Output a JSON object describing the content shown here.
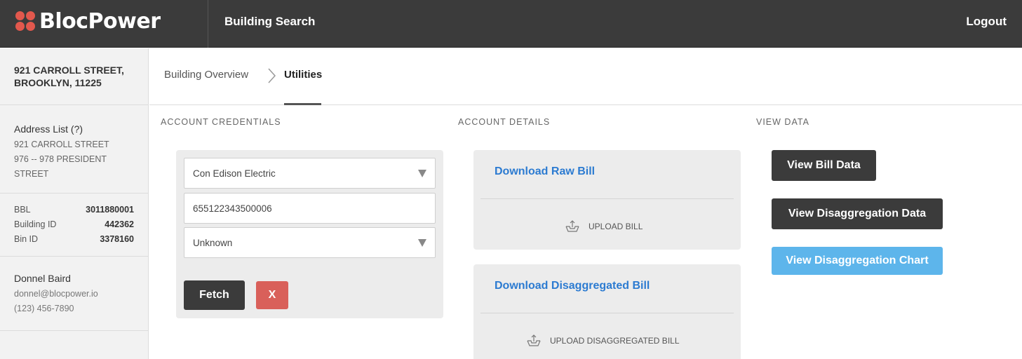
{
  "header": {
    "brand": "BlocPower",
    "nav_link": "Building Search",
    "logout": "Logout",
    "brand_color": "#e2584d"
  },
  "sidebar": {
    "address": "921 CARROLL STREET, BROOKLYN, 11225",
    "address_list": {
      "title": "Address List (?)",
      "items": [
        "921 CARROLL STREET",
        "976 -- 978 PRESIDENT STREET"
      ]
    },
    "ids": [
      {
        "label": "BBL",
        "value": "3011880001"
      },
      {
        "label": "Building ID",
        "value": "442362"
      },
      {
        "label": "Bin ID",
        "value": "3378160"
      }
    ],
    "contact": {
      "name": "Donnel Baird",
      "email": "donnel@blocpower.io",
      "phone": "(123) 456-7890"
    }
  },
  "breadcrumb": {
    "items": [
      "Building Overview",
      "Utilities"
    ],
    "separator_icon": "chevron-right-icon"
  },
  "columns": {
    "credentials": "ACCOUNT CREDENTIALS",
    "details": "ACCOUNT DETAILS",
    "view": "VIEW DATA"
  },
  "credentials": {
    "utility_select": "Con Edison Electric",
    "account_number": "655122343500006",
    "status_select": "Unknown",
    "fetch_label": "Fetch",
    "clear_label": "X"
  },
  "details": {
    "raw_bill_link": "Download Raw Bill",
    "upload_bill": "UPLOAD BILL",
    "disagg_bill_link": "Download Disaggregated Bill",
    "upload_disagg": "UPLOAD DISAGGREGATED BILL",
    "upload_icon": "upload-icon"
  },
  "view_data": {
    "bill_data": "View Bill Data",
    "disagg_data": "View Disaggregation Data",
    "disagg_chart": "View Disaggregation Chart"
  }
}
